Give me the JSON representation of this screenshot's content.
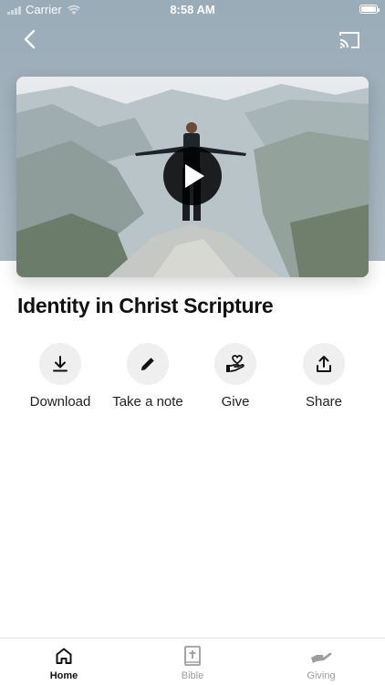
{
  "status_bar": {
    "carrier": "Carrier",
    "time": "8:58 AM"
  },
  "nav": {
    "back_icon": "chevron-left-icon",
    "cast_icon": "cast-icon"
  },
  "video": {
    "play_icon": "play-icon"
  },
  "title": "Identity in Christ Scripture",
  "actions": [
    {
      "label": "Download",
      "icon": "download-icon"
    },
    {
      "label": "Take a note",
      "icon": "pencil-icon"
    },
    {
      "label": "Give",
      "icon": "heart-hand-icon"
    },
    {
      "label": "Share",
      "icon": "share-icon"
    }
  ],
  "tabs": [
    {
      "label": "Home",
      "icon": "home-icon",
      "active": true
    },
    {
      "label": "Bible",
      "icon": "bible-icon",
      "active": false
    },
    {
      "label": "Giving",
      "icon": "giving-icon",
      "active": false
    }
  ],
  "colors": {
    "hero_bg": "#a3b3be",
    "action_circle": "#efefef",
    "tab_active": "#111111",
    "tab_inactive": "#9d9d9d"
  }
}
